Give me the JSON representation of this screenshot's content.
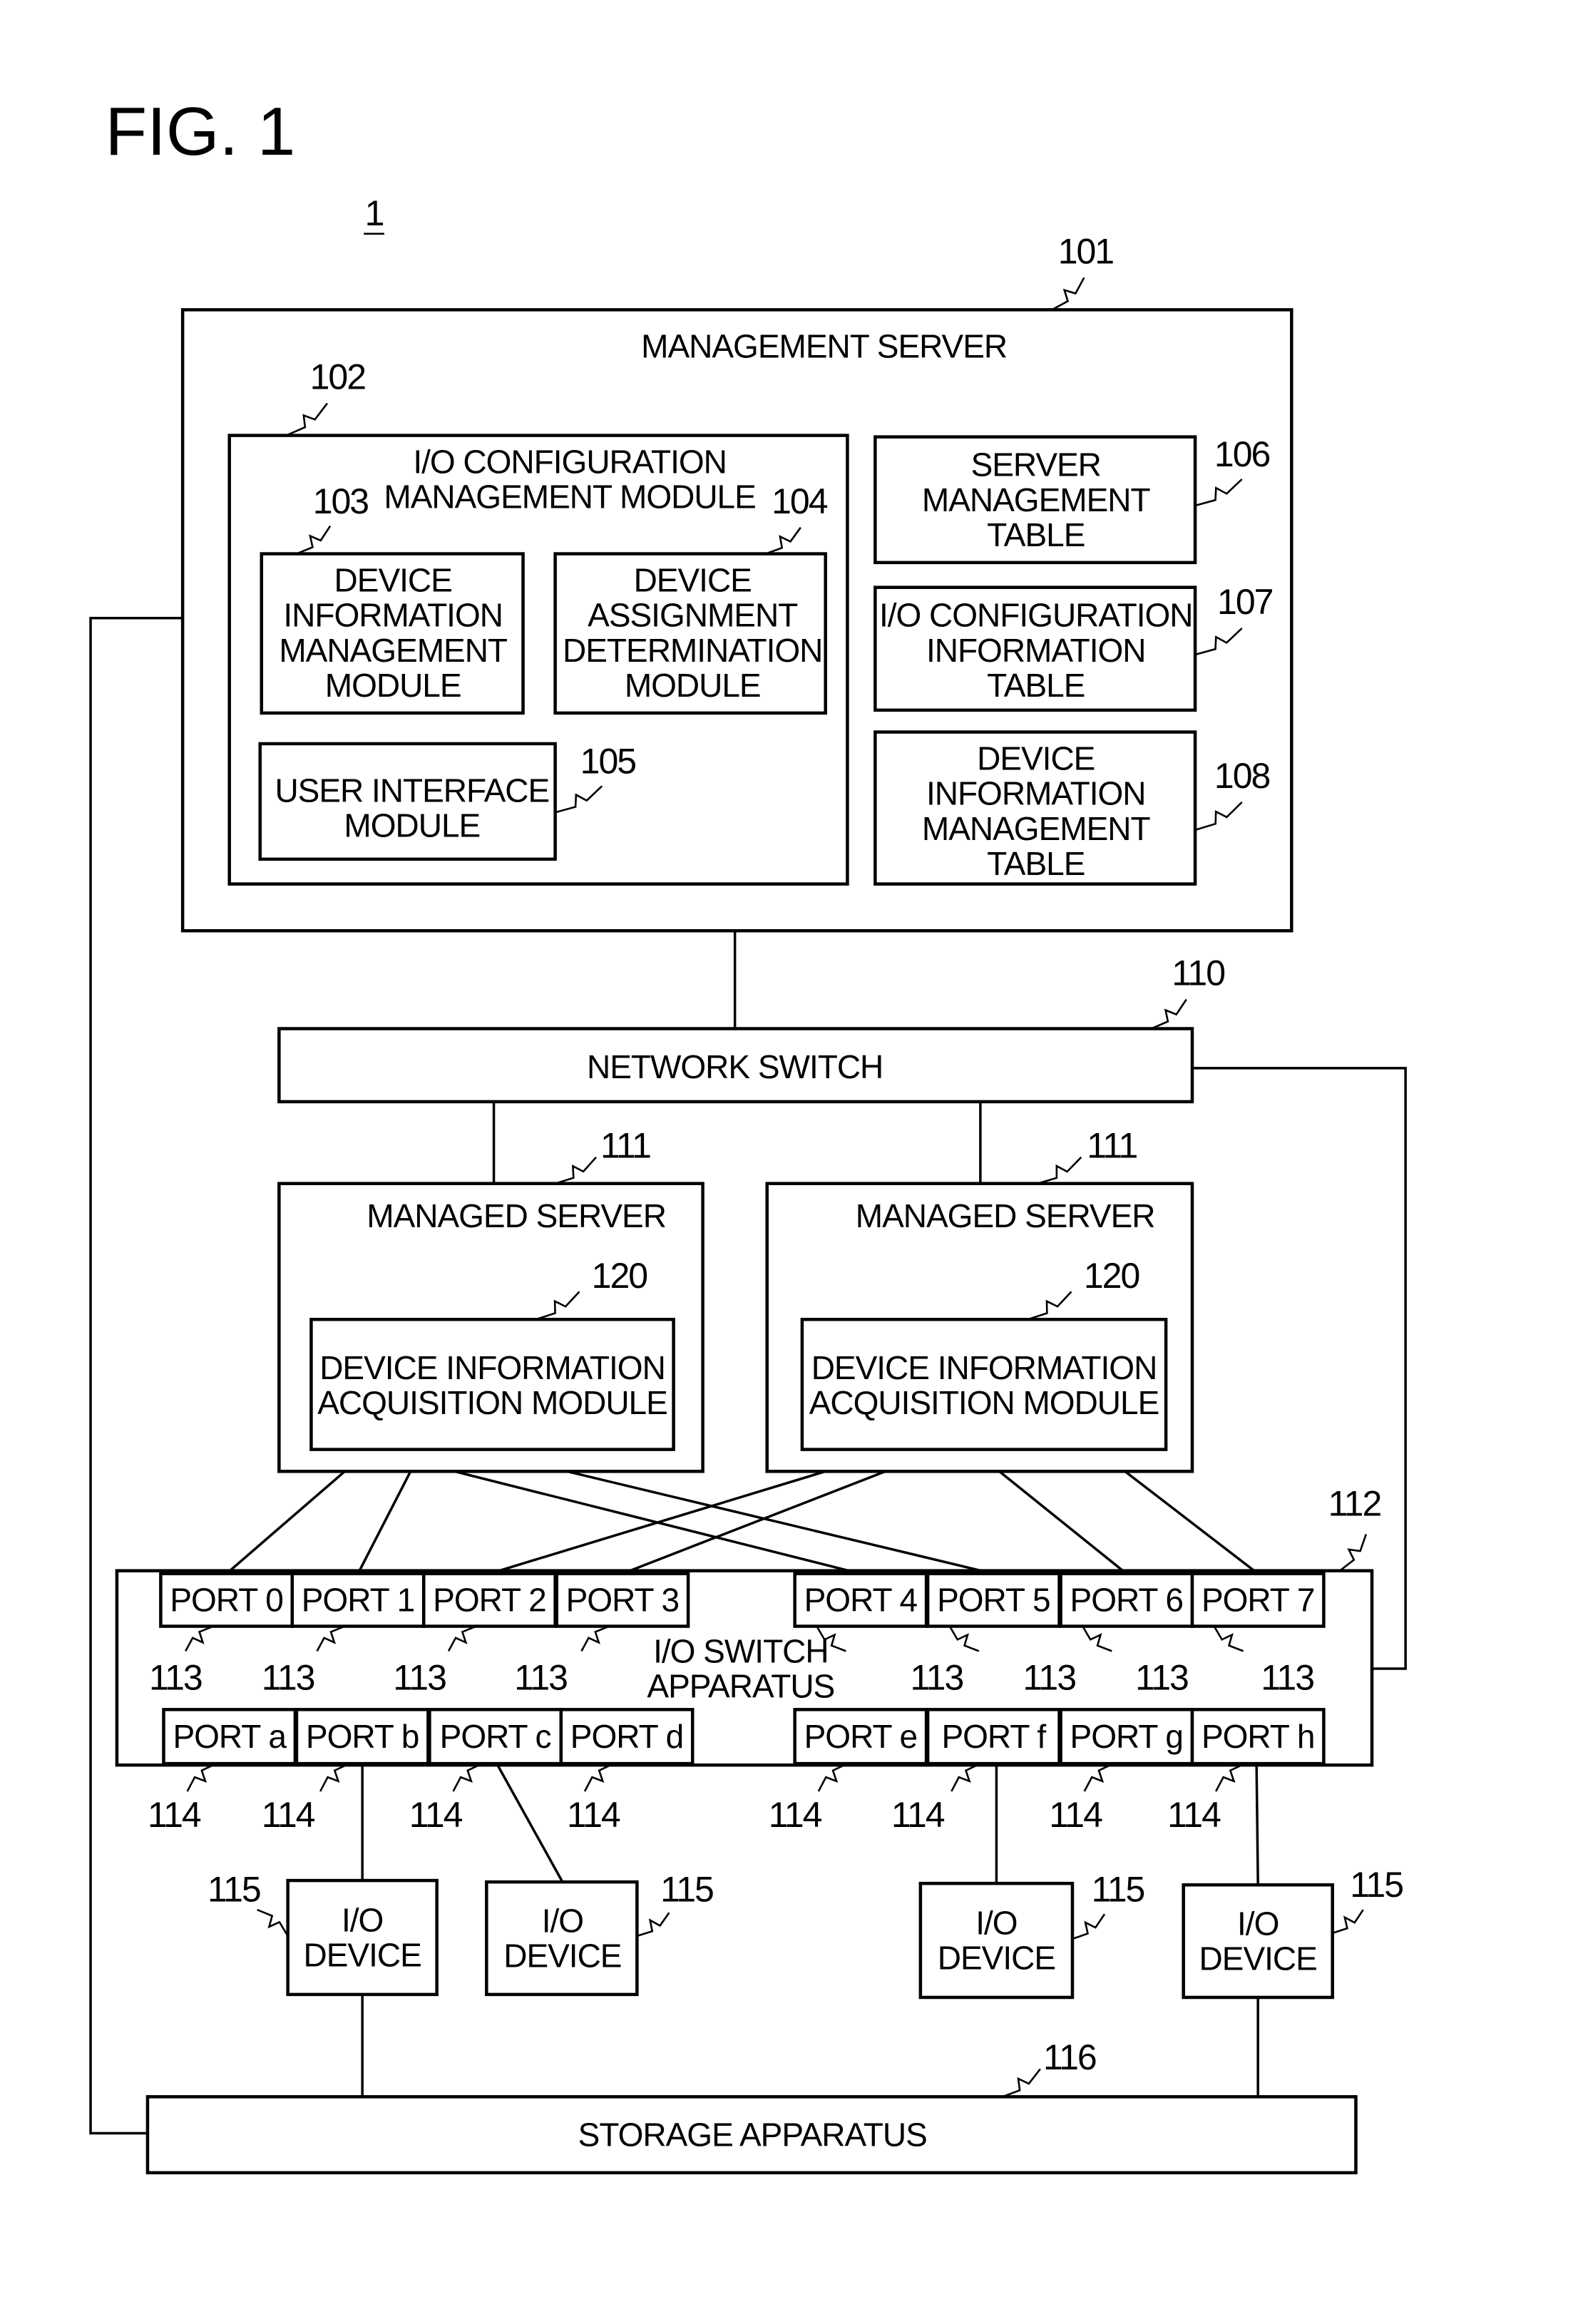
{
  "figure": {
    "title": "FIG. 1",
    "system_ref": "1"
  },
  "management_server": {
    "ref": "101",
    "label": "MANAGEMENT SERVER",
    "io_config_module": {
      "ref": "102",
      "label": [
        "I/O CONFIGURATION",
        "MANAGEMENT MODULE"
      ],
      "device_info_mgmt_module": {
        "ref": "103",
        "label": [
          "DEVICE",
          "INFORMATION",
          "MANAGEMENT",
          "MODULE"
        ]
      },
      "device_assignment_module": {
        "ref": "104",
        "label": [
          "DEVICE",
          "ASSIGNMENT",
          "DETERMINATION",
          "MODULE"
        ]
      },
      "user_interface_module": {
        "ref": "105",
        "label": [
          "USER INTERFACE",
          "MODULE"
        ]
      }
    },
    "server_mgmt_table": {
      "ref": "106",
      "label": [
        "SERVER",
        "MANAGEMENT",
        "TABLE"
      ]
    },
    "io_config_info_table": {
      "ref": "107",
      "label": [
        "I/O CONFIGURATION",
        "INFORMATION",
        "TABLE"
      ]
    },
    "device_info_mgmt_table": {
      "ref": "108",
      "label": [
        "DEVICE",
        "INFORMATION",
        "MANAGEMENT",
        "TABLE"
      ]
    }
  },
  "network_switch": {
    "ref": "110",
    "label": "NETWORK SWITCH"
  },
  "managed_servers": [
    {
      "ref": "111",
      "label": "MANAGED SERVER",
      "module": {
        "ref": "120",
        "label": [
          "DEVICE INFORMATION",
          "ACQUISITION MODULE"
        ]
      }
    },
    {
      "ref": "111",
      "label": "MANAGED SERVER",
      "module": {
        "ref": "120",
        "label": [
          "DEVICE INFORMATION",
          "ACQUISITION MODULE"
        ]
      }
    }
  ],
  "io_switch": {
    "ref": "112",
    "label": [
      "I/O SWITCH",
      "APPARATUS"
    ],
    "upper_port_ref": "113",
    "lower_port_ref": "114",
    "upper_ports": [
      "PORT 0",
      "PORT 1",
      "PORT 2",
      "PORT 3",
      "PORT 4",
      "PORT 5",
      "PORT 6",
      "PORT 7"
    ],
    "lower_ports": [
      "PORT a",
      "PORT b",
      "PORT c",
      "PORT d",
      "PORT e",
      "PORT f",
      "PORT g",
      "PORT h"
    ]
  },
  "io_devices": [
    {
      "ref": "115",
      "label": [
        "I/O",
        "DEVICE"
      ]
    },
    {
      "ref": "115",
      "label": [
        "I/O",
        "DEVICE"
      ]
    },
    {
      "ref": "115",
      "label": [
        "I/O",
        "DEVICE"
      ]
    },
    {
      "ref": "115",
      "label": [
        "I/O",
        "DEVICE"
      ]
    }
  ],
  "storage_apparatus": {
    "ref": "116",
    "label": "STORAGE APPARATUS"
  },
  "connections": {
    "server_to_ports": [
      {
        "server": 0,
        "ports": [
          "PORT 0",
          "PORT 1",
          "PORT 4",
          "PORT 5"
        ]
      },
      {
        "server": 1,
        "ports": [
          "PORT 2",
          "PORT 3",
          "PORT 6",
          "PORT 7"
        ]
      }
    ],
    "port_to_device": [
      {
        "port": "PORT b",
        "device": 0
      },
      {
        "port": "PORT c",
        "device": 1
      },
      {
        "port": "PORT f",
        "device": 2
      },
      {
        "port": "PORT h",
        "device": 3
      }
    ],
    "device_to_storage": [
      0,
      3
    ]
  }
}
